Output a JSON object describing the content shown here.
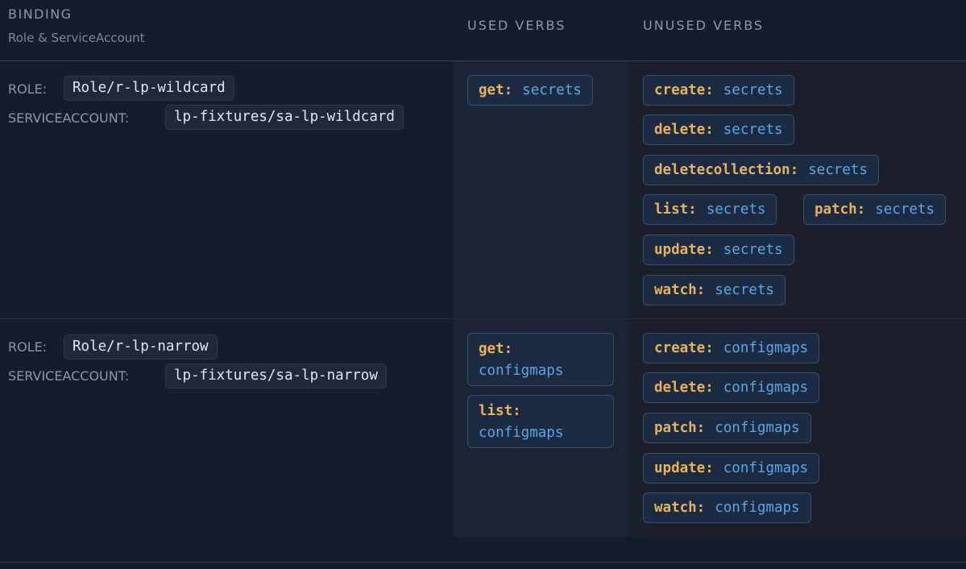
{
  "header": {
    "binding": "BINDING",
    "binding_sub": "Role & ServiceAccount",
    "used_verbs": "USED VERBS",
    "unused_verbs": "UNUSED VERBS"
  },
  "labels": {
    "role": "ROLE:",
    "serviceaccount": "SERVICEACCOUNT:"
  },
  "bindings": [
    {
      "role": "Role/r-lp-wildcard",
      "serviceaccount": "lp-fixtures/sa-lp-wildcard",
      "used": [
        {
          "verb": "get:",
          "resource": "secrets"
        }
      ],
      "unused": [
        {
          "verb": "create:",
          "resource": "secrets"
        },
        {
          "verb": "delete:",
          "resource": "secrets"
        },
        {
          "verb": "deletecollection:",
          "resource": "secrets"
        },
        {
          "verb": "list:",
          "resource": "secrets"
        },
        {
          "verb": "patch:",
          "resource": "secrets"
        },
        {
          "verb": "update:",
          "resource": "secrets"
        },
        {
          "verb": "watch:",
          "resource": "secrets"
        }
      ]
    },
    {
      "role": "Role/r-lp-narrow",
      "serviceaccount": "lp-fixtures/sa-lp-narrow",
      "used": [
        {
          "verb": "get:",
          "resource": "configmaps"
        },
        {
          "verb": "list:",
          "resource": "configmaps"
        }
      ],
      "unused": [
        {
          "verb": "create:",
          "resource": "configmaps"
        },
        {
          "verb": "delete:",
          "resource": "configmaps"
        },
        {
          "verb": "patch:",
          "resource": "configmaps"
        },
        {
          "verb": "update:",
          "resource": "configmaps"
        },
        {
          "verb": "watch:",
          "resource": "configmaps"
        }
      ]
    }
  ],
  "colors": {
    "background": "#161c2b",
    "used_column": "#1a2435",
    "unused_column": "#1b1f2c",
    "verb": "#e8b25c",
    "resource": "#5aa6e8",
    "chip_border": "#35506f"
  }
}
